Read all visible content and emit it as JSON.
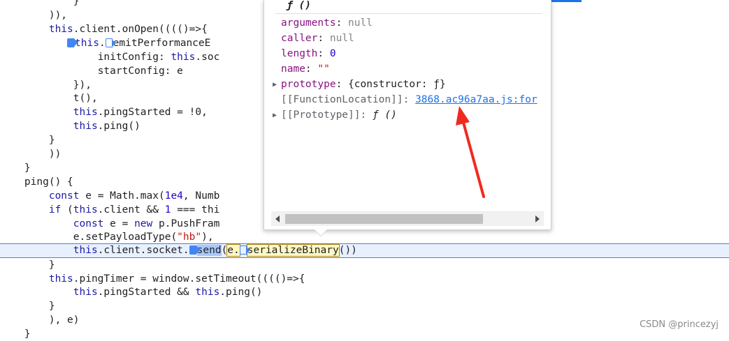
{
  "code": {
    "lines": [
      {
        "pre": "            ",
        "parts": [
          {
            "t": "}",
            "c": ""
          }
        ]
      },
      {
        "pre": "        ",
        "parts": [
          {
            "t": ")),",
            "c": ""
          }
        ]
      },
      {
        "pre": "        ",
        "parts": [
          {
            "t": "this",
            "c": "kw"
          },
          {
            "t": ".client.onOpen(((()=>{",
            "c": ""
          }
        ]
      },
      {
        "pre": "            ",
        "bp": "solid",
        "parts": [
          {
            "t": "this",
            "c": "kw"
          },
          {
            "t": ".",
            "c": ""
          },
          {
            "bp": "hollow"
          },
          {
            "t": "emitPerformanceE",
            "c": ""
          }
        ]
      },
      {
        "pre": "                ",
        "parts": [
          {
            "t": "initConfig: ",
            "c": ""
          },
          {
            "t": "this",
            "c": "kw"
          },
          {
            "t": ".soc",
            "c": ""
          }
        ]
      },
      {
        "pre": "                ",
        "parts": [
          {
            "t": "startConfig: e",
            "c": ""
          }
        ]
      },
      {
        "pre": "            ",
        "parts": [
          {
            "t": "}),",
            "c": ""
          }
        ]
      },
      {
        "pre": "            ",
        "parts": [
          {
            "t": "t(),",
            "c": ""
          }
        ]
      },
      {
        "pre": "            ",
        "parts": [
          {
            "t": "this",
            "c": "kw"
          },
          {
            "t": ".pingStarted = !0,",
            "c": ""
          }
        ]
      },
      {
        "pre": "            ",
        "parts": [
          {
            "t": "this",
            "c": "kw"
          },
          {
            "t": ".ping()",
            "c": ""
          }
        ]
      },
      {
        "pre": "        ",
        "parts": [
          {
            "t": "}",
            "c": ""
          }
        ]
      },
      {
        "pre": "        ",
        "parts": [
          {
            "t": "))",
            "c": ""
          }
        ]
      },
      {
        "pre": "    ",
        "parts": [
          {
            "t": "}",
            "c": ""
          }
        ]
      },
      {
        "pre": "    ",
        "parts": [
          {
            "t": "ping() {",
            "c": ""
          }
        ]
      },
      {
        "pre": "        ",
        "parts": [
          {
            "t": "const",
            "c": "kw"
          },
          {
            "t": " e = Math.max(",
            "c": ""
          },
          {
            "t": "1e4",
            "c": "num"
          },
          {
            "t": ", Numb",
            "c": ""
          }
        ]
      },
      {
        "pre": "        ",
        "parts": [
          {
            "t": "if",
            "c": "kw"
          },
          {
            "t": " (",
            "c": ""
          },
          {
            "t": "this",
            "c": "kw"
          },
          {
            "t": ".client && ",
            "c": ""
          },
          {
            "t": "1",
            "c": "num"
          },
          {
            "t": " === thi",
            "c": ""
          }
        ]
      },
      {
        "pre": "            ",
        "parts": [
          {
            "t": "const",
            "c": "kw"
          },
          {
            "t": " e = ",
            "c": ""
          },
          {
            "t": "new",
            "c": "kw"
          },
          {
            "t": " p.PushFram",
            "c": ""
          }
        ]
      },
      {
        "pre": "            ",
        "parts": [
          {
            "t": "e.setPayloadType(",
            "c": ""
          },
          {
            "t": "\"hb\"",
            "c": "str"
          },
          {
            "t": "),",
            "c": ""
          }
        ]
      },
      {
        "pre": "            ",
        "current": true,
        "parts": [
          {
            "t": "this",
            "c": "kw"
          },
          {
            "t": ".client.socket.",
            "c": ""
          },
          {
            "bp": "solid"
          },
          {
            "t": "send",
            "c": "hl-send"
          },
          {
            "t": "(",
            "c": ""
          },
          {
            "t": "e.",
            "c": "hl-box"
          },
          {
            "bp": "hollow"
          },
          {
            "t": "serializeBinary",
            "c": "hl-box"
          },
          {
            "t": "())",
            "c": ""
          }
        ]
      },
      {
        "pre": "        ",
        "parts": [
          {
            "t": "}",
            "c": ""
          }
        ]
      },
      {
        "pre": "        ",
        "parts": [
          {
            "t": "this",
            "c": "kw"
          },
          {
            "t": ".pingTimer = window.setTimeout(((()=>{",
            "c": ""
          }
        ]
      },
      {
        "pre": "            ",
        "parts": [
          {
            "t": "this",
            "c": "kw"
          },
          {
            "t": ".pingStarted && ",
            "c": ""
          },
          {
            "t": "this",
            "c": "kw"
          },
          {
            "t": ".ping()",
            "c": ""
          }
        ]
      },
      {
        "pre": "        ",
        "parts": [
          {
            "t": "}",
            "c": ""
          }
        ]
      },
      {
        "pre": "        ",
        "parts": [
          {
            "t": "), e)",
            "c": ""
          }
        ]
      },
      {
        "pre": "    ",
        "parts": [
          {
            "t": "}",
            "c": ""
          }
        ]
      }
    ]
  },
  "popover": {
    "title": "ƒ ()",
    "props": [
      {
        "name": "arguments",
        "sep": ": ",
        "value": "null",
        "vclass": "pval-null"
      },
      {
        "name": "caller",
        "sep": ": ",
        "value": "null",
        "vclass": "pval-null"
      },
      {
        "name": "length",
        "sep": ": ",
        "value": "0",
        "vclass": "pval-num"
      },
      {
        "name": "name",
        "sep": ": ",
        "value": "\"\"",
        "vclass": "pval-str"
      },
      {
        "name": "prototype",
        "sep": ": ",
        "value": "{constructor: ƒ}",
        "vclass": "pval-obj",
        "expand": true
      },
      {
        "name": "[[FunctionLocation]]",
        "sep": ": ",
        "value": "3868.ac96a7aa.js:for",
        "vclass": "link",
        "internal": true
      },
      {
        "name": "[[Prototype]]",
        "sep": ": ",
        "value": "ƒ ()",
        "vclass": "pval-obj fn-italic",
        "internal": true,
        "expand": true
      }
    ]
  },
  "watermark": "CSDN @princezyj",
  "colors": {
    "accent": "#1a73e8",
    "annotation_arrow": "#f02a1e"
  }
}
